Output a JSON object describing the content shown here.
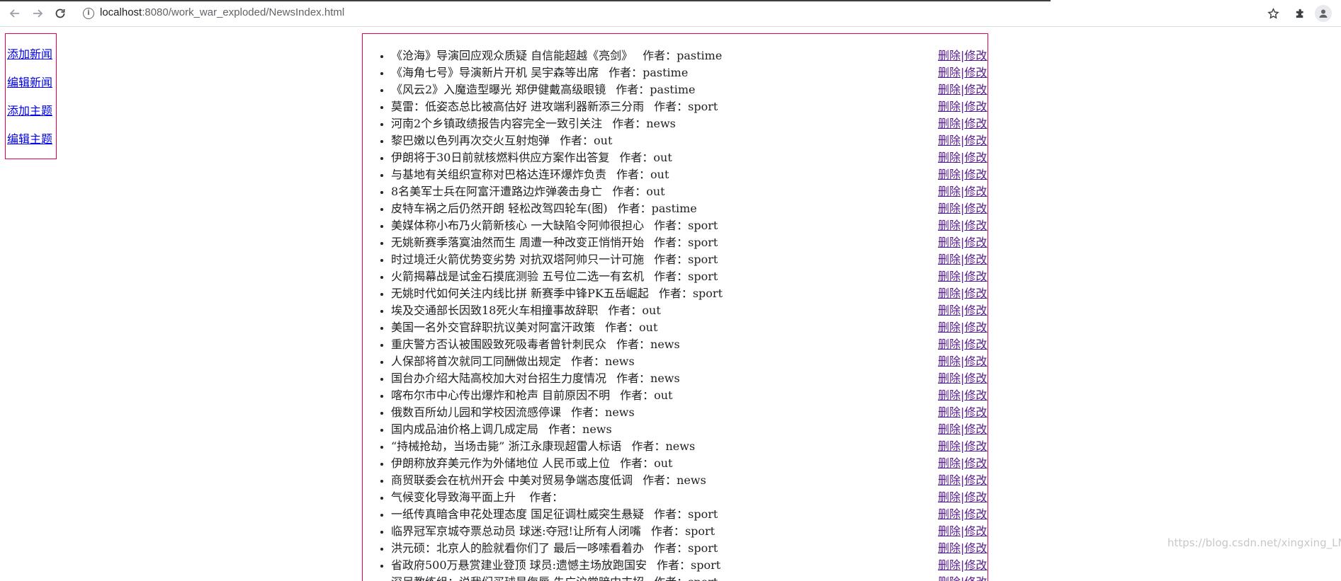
{
  "browser": {
    "url_host": "localhost",
    "url_rest": ":8080/work_war_exploded/NewsIndex.html"
  },
  "sidebar": {
    "items": [
      {
        "label": "添加新闻"
      },
      {
        "label": "编辑新闻"
      },
      {
        "label": "添加主题"
      },
      {
        "label": "编辑主题"
      }
    ]
  },
  "news": {
    "author_label": "作者：",
    "delete_label": "删除",
    "separator": "|",
    "edit_label": "修改",
    "items": [
      {
        "title": "《沧海》导演回应观众质疑 自信能超越《亮剑》",
        "author": "pastime"
      },
      {
        "title": "《海角七号》导演新片开机 吴宇森等出席",
        "author": "pastime"
      },
      {
        "title": "《风云2》入魔造型曝光 郑伊健戴高级眼镜",
        "author": "pastime"
      },
      {
        "title": "莫雷：低姿态总比被高估好 进攻端利器新添三分雨",
        "author": "sport"
      },
      {
        "title": "河南2个乡镇政绩报告内容完全一致引关注",
        "author": "news"
      },
      {
        "title": "黎巴嫩以色列再次交火互射炮弹",
        "author": "out"
      },
      {
        "title": "伊朗将于30日前就核燃料供应方案作出答复",
        "author": "out"
      },
      {
        "title": "与基地有关组织宣称对巴格达连环爆炸负责",
        "author": "out"
      },
      {
        "title": "8名美军士兵在阿富汗遭路边炸弹袭击身亡",
        "author": "out"
      },
      {
        "title": "皮特车祸之后仍然开朗 轻松改驾四轮车(图)",
        "author": "pastime"
      },
      {
        "title": "美媒体称小布乃火箭新核心 一大缺陷令阿帅很担心",
        "author": "sport"
      },
      {
        "title": "无姚新赛季落寞油然而生 周遭一种改变正悄悄开始",
        "author": "sport"
      },
      {
        "title": "时过境迁火箭优势变劣势 对抗双塔阿帅只一计可施",
        "author": "sport"
      },
      {
        "title": "火箭揭幕战是试金石摸底测验 五号位二选一有玄机",
        "author": "sport"
      },
      {
        "title": "无姚时代如何关注内线比拼 新赛季中锋PK五岳崛起",
        "author": "sport"
      },
      {
        "title": "埃及交通部长因致18死火车相撞事故辞职",
        "author": "out"
      },
      {
        "title": "美国一名外交官辞职抗议美对阿富汗政策",
        "author": "out"
      },
      {
        "title": "重庆警方否认被围殴致死吸毒者曾针刺民众",
        "author": "news"
      },
      {
        "title": "人保部将首次就同工同酬做出规定",
        "author": "news"
      },
      {
        "title": "国台办介绍大陆高校加大对台招生力度情况",
        "author": "news"
      },
      {
        "title": "喀布尔市中心传出爆炸和枪声 目前原因不明",
        "author": "out"
      },
      {
        "title": "俄数百所幼儿园和学校因流感停课",
        "author": "news"
      },
      {
        "title": "国内成品油价格上调几成定局",
        "author": "news"
      },
      {
        "title": "“持械抢劫，当场击毙” 浙江永康现超雷人标语",
        "author": "news"
      },
      {
        "title": "伊朗称放弃美元作为外储地位 人民币或上位",
        "author": "out"
      },
      {
        "title": "商贸联委会在杭州开会 中美对贸易争端态度低调",
        "author": "news"
      },
      {
        "title": "气候变化导致海平面上升 ",
        "author": ""
      },
      {
        "title": "一纸传真暗含申花处理态度 国足征调杜威突生悬疑",
        "author": "sport"
      },
      {
        "title": "临界冠军京城夺票总动员 球迷:夺冠!让所有人闭嘴",
        "author": "sport"
      },
      {
        "title": "洪元硕：北京人的脸就看你们了 最后一哆嗦看着办",
        "author": "sport"
      },
      {
        "title": "省政府500万悬赏建业登顶 球员:遗憾主场放跑国安",
        "author": "sport"
      },
      {
        "title": "深足教练组：说我们买球是侮辱 朱广沪常暗中支招",
        "author": "sport"
      }
    ]
  },
  "watermark": "https://blog.csdn.net/xingxing_LM"
}
